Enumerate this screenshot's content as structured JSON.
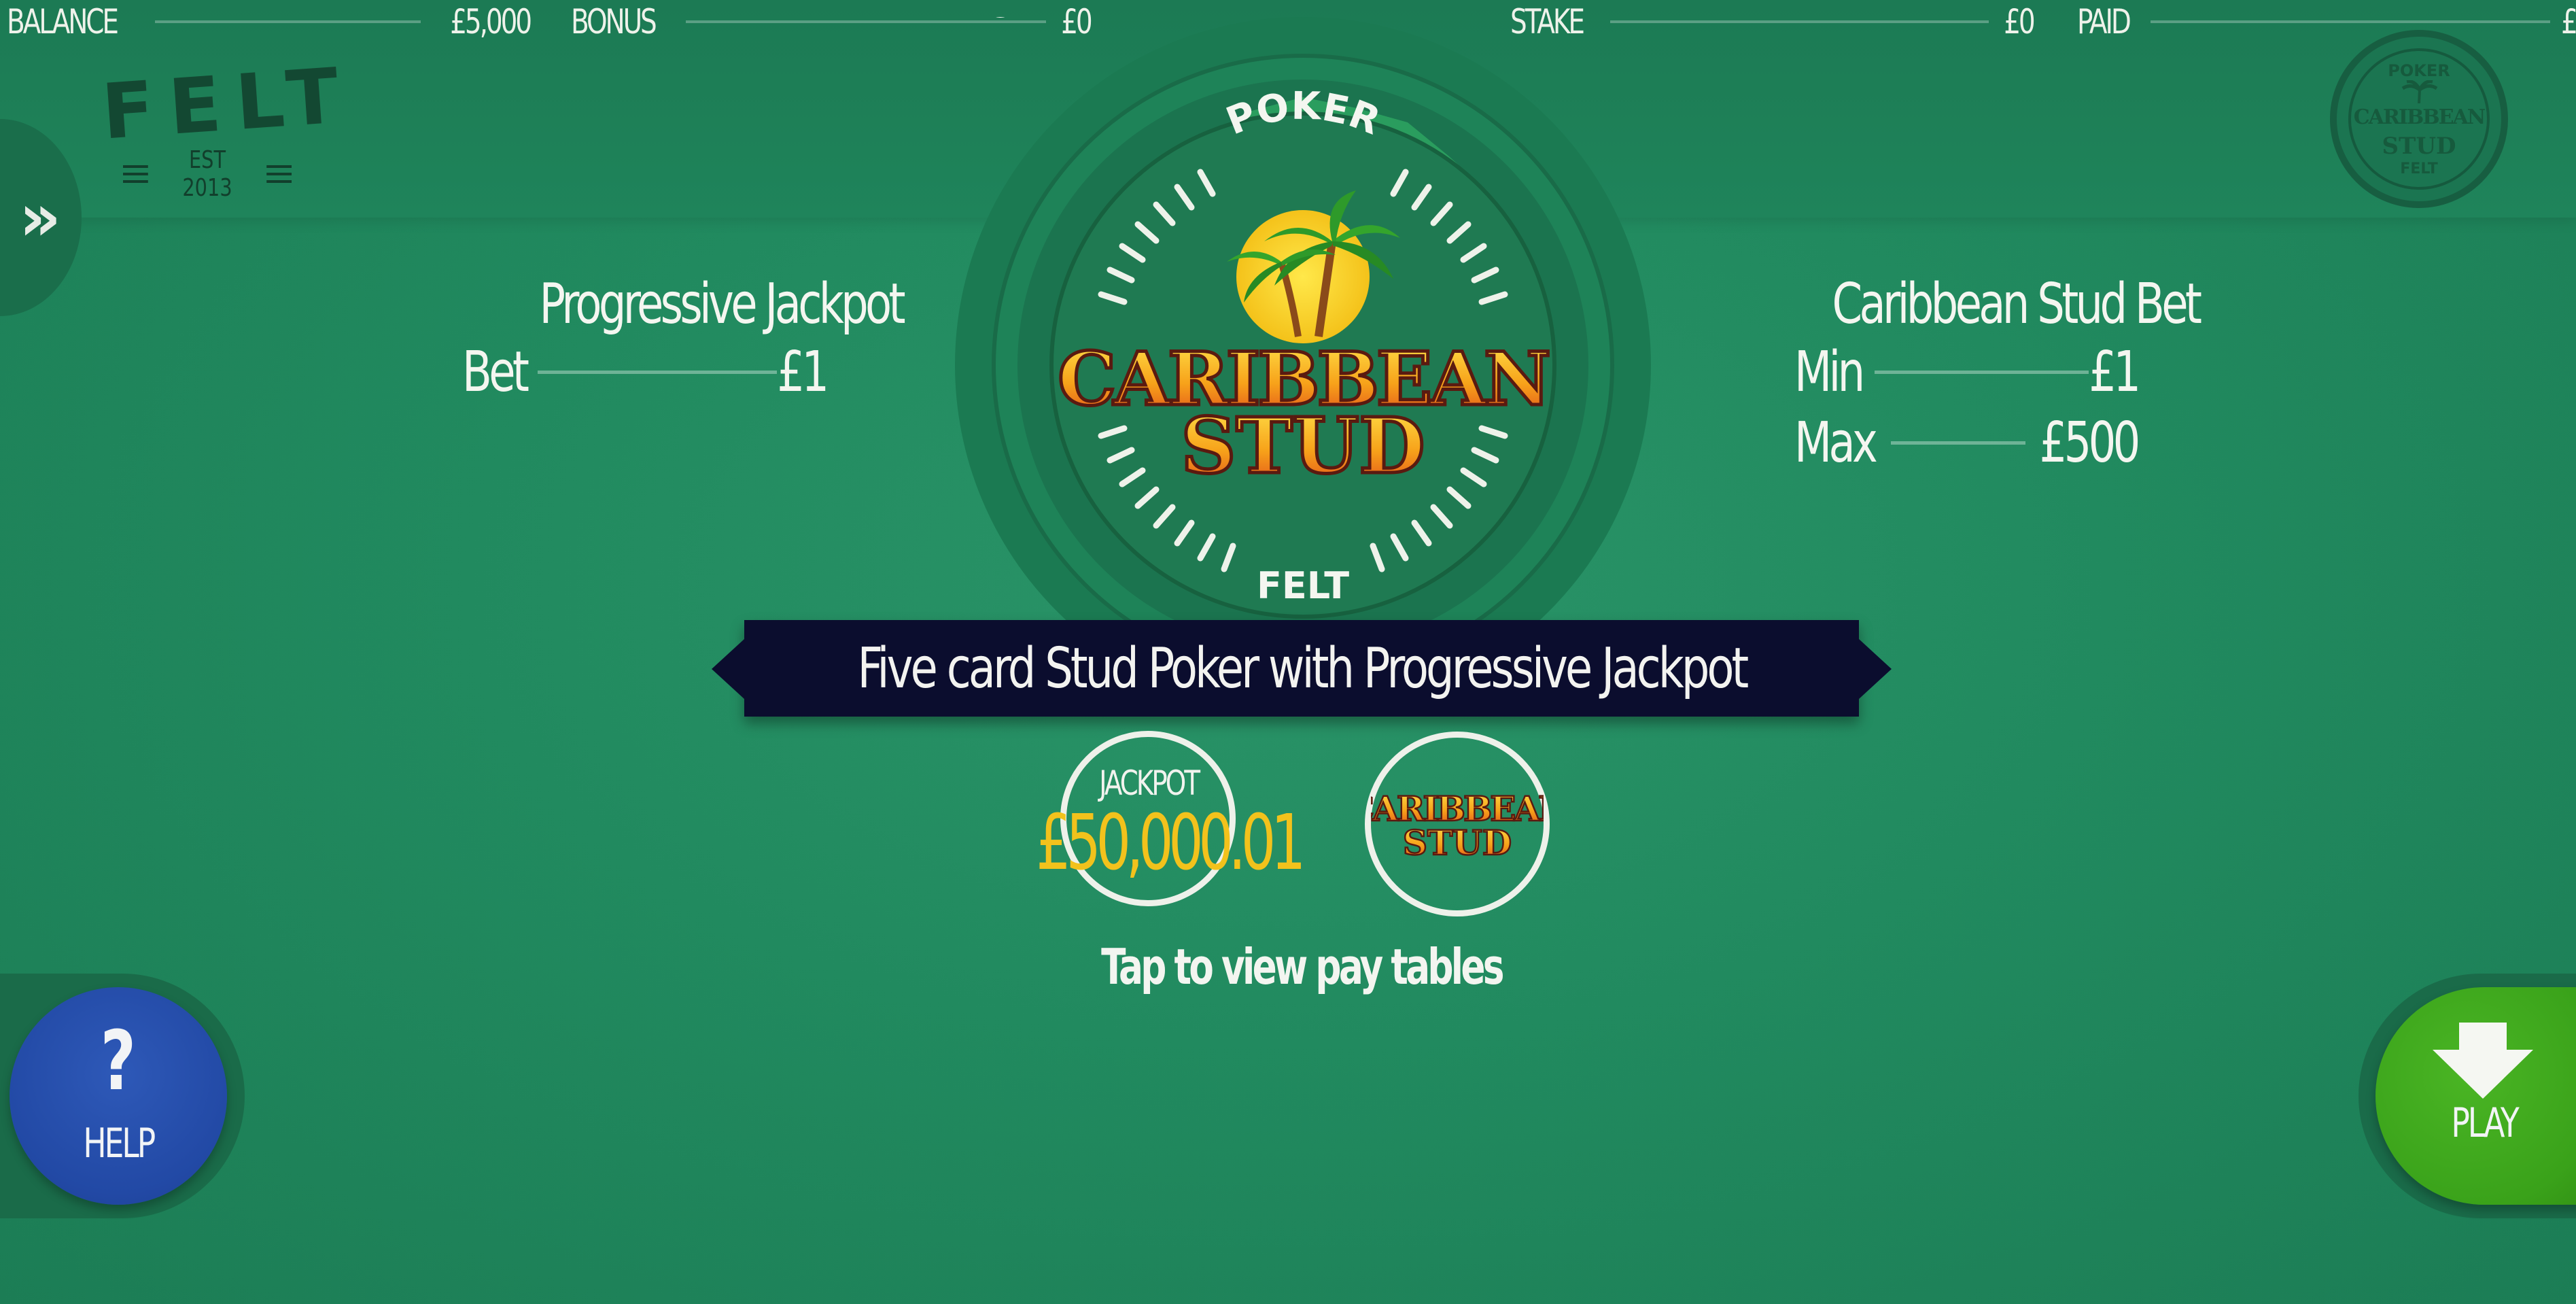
{
  "stats": {
    "balance_label": "BALANCE",
    "balance_value": "£5,000",
    "bonus_label": "BONUS",
    "bonus_value": "£0",
    "stake_label": "STAKE",
    "stake_value": "£0",
    "paid_label": "PAID",
    "paid_value": "£"
  },
  "logo": {
    "word": "FELT",
    "est": "EST 2013"
  },
  "menu": {
    "toggle_glyph": "»"
  },
  "emblem": {
    "top_text": "POKER",
    "inner_top": "POKER",
    "title_line1": "CARIBBEAN",
    "title_line2": "STUD",
    "bottom_text": "FELT"
  },
  "badge": {
    "top": "POKER",
    "line1": "CARIBBEAN",
    "line2": "STUD",
    "bottom": "FELT"
  },
  "progressive": {
    "heading": "Progressive Jackpot",
    "bet_label": "Bet",
    "bet_value": "£1"
  },
  "caribbean_bet": {
    "heading": "Caribbean Stud Bet",
    "min_label": "Min",
    "min_value": "£1",
    "max_label": "Max",
    "max_value": "£500"
  },
  "ribbon": {
    "text": "Five card Stud Poker with Progressive Jackpot"
  },
  "jackpot": {
    "label": "JACKPOT",
    "amount": "£50,000.01"
  },
  "small_logo": {
    "line1": "CARIBBEAN",
    "line2": "STUD"
  },
  "paytable": {
    "hint": "Tap to view pay tables"
  },
  "buttons": {
    "help_symbol": "?",
    "help_label": "HELP",
    "play_label": "PLAY"
  },
  "colors": {
    "felt_green": "#21895e",
    "jackpot_gold": "#f2c21c",
    "ribbon_navy": "#0b0d2e",
    "help_blue": "#2249a5",
    "play_green": "#3aa21a"
  }
}
